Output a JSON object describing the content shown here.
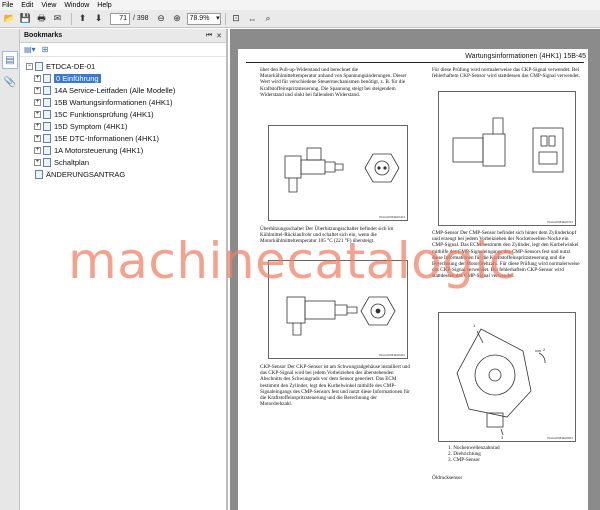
{
  "menu": [
    "File",
    "Edit",
    "View",
    "Window",
    "Help"
  ],
  "toolbar": {
    "page_current": "71",
    "page_total": "/ 398",
    "zoom": "78.9%"
  },
  "bookmarks": {
    "title": "Bookmarks",
    "items": [
      {
        "label": "ETDCA-DE-01",
        "level": 0,
        "expander": "−"
      },
      {
        "label": "0 Einführung",
        "level": 1,
        "expander": "+",
        "selected": true
      },
      {
        "label": "14A Service-Leitfaden (Alle Modelle)",
        "level": 1,
        "expander": "+"
      },
      {
        "label": "15B Wartungsinformationen (4HK1)",
        "level": 1,
        "expander": "+"
      },
      {
        "label": "15C Funktionsprüfung (4HK1)",
        "level": 1,
        "expander": "+"
      },
      {
        "label": "15D Symptom (4HK1)",
        "level": 1,
        "expander": "+"
      },
      {
        "label": "15E DTC-Informationen (4HK1)",
        "level": 1,
        "expander": "+"
      },
      {
        "label": "1A Motorsteuerung (4HK1)",
        "level": 1,
        "expander": "+"
      },
      {
        "label": "Schaltplan",
        "level": 1,
        "expander": "+"
      },
      {
        "label": "ÄNDERUNGSANTRAG",
        "level": 0,
        "expander": ""
      }
    ]
  },
  "document": {
    "header": "Wartungsinformationen (4HK1)   15B-45",
    "left_top_text": "über den Pull-up-Widerstand und berechnet die Motorkühlmitteltemperatur anhand von Spannungsänderungen. Dieser Wert wird für verschiedene Steuermechanismen benötigt, z. B. für die Kraftstoffeinspritzsteuerung. Die Spannung steigt bei steigendem Widerstand und sinkt bei fallendem Widerstand.",
    "fig1_code": "PAAA2D0NE00401",
    "ueberhitzung_text": "Überhitzungsschalter Der Überhitzungsschalter befindet sich im Kühlmittel-Rücklaufrohr und schaltet sich ein, wenn die Motorkühlmitteltemperatur 105 °C (221 °F) übersteigt.",
    "fig2_code": "PAAA2D0NE00401",
    "ckp_text": "CKP-Sensor Der CKP-Sensor ist am Schwungradgehäuse installiert und das CKP-Signal wird bei jedem Vorbeiziehen des überstehenden Abschnitts des Schwungrads vor dem Sensor generiert. Das ECM bestimmt den Zylinder, legt den Kurbelwinkel mithilfe des CMP-Signaleingangs des CMP-Sensors fest und nutzt diese Informationen für die Kraftstoffeinspritzsteuerung und die Berechnung der Motordrehzahl.",
    "right_top_text": "Für diese Prüfung wird normalerweise das CKP-Signal verwendet. Bei fehlerhaftem CKP-Sensor wird stattdessen das CMP-Signal verwendet.",
    "fig3_code": "PAAA2D0NE00701",
    "cmp_text": "CMP-Sensor Der CMP-Sensor befindet sich hinter dem Zylinderkopf und erzeugt bei jedem Vorbeiziehen der Nockenwellen-Nocke ein CMP-Signal. Das ECM bestimmt den Zylinder, legt den Kurbelwinkel mithilfe des CMP-Signaleingangs des CMP-Sensors fest und nutzt diese Informationen für die Kraftstoffeinspritzsteuerung und die Berechnung der Motordrehzahl. Für diese Prüfung wird normalerweise das CKP-Signal verwendet. Bei fehlerhaftem CKP-Sensor wird stattdessen das CMP-Signal verwendet.",
    "fig4_code": "PAAA2D0NE00801",
    "legend": [
      "1.   Nockenwellenzahnrad",
      "2.   Drehrichtung",
      "3.   CMP-Sensor"
    ],
    "oeldruck": "Öldrucksensor"
  },
  "watermark": "machinecatalogic"
}
